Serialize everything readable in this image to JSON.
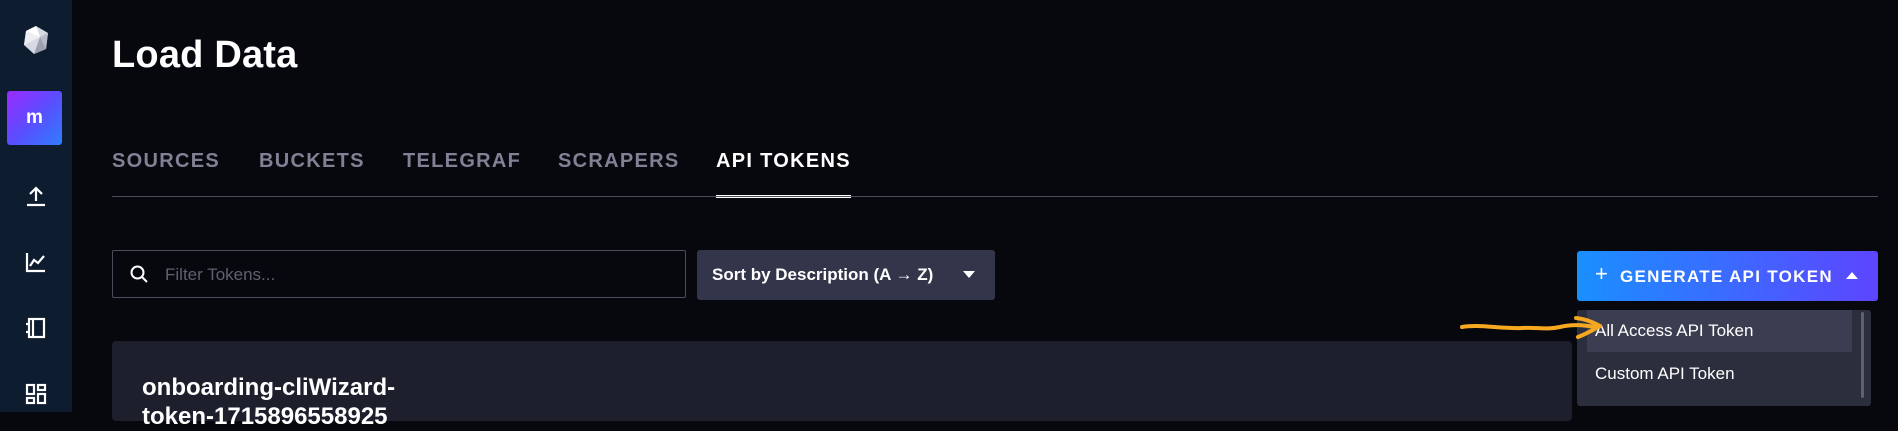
{
  "page": {
    "title": "Load Data"
  },
  "sidebar": {
    "org_initial": "m",
    "items": [
      {
        "name": "load-data",
        "icon": "upload-icon"
      },
      {
        "name": "explore",
        "icon": "chart-icon"
      },
      {
        "name": "notebooks",
        "icon": "notebook-icon"
      },
      {
        "name": "dashboards",
        "icon": "dashboard-icon"
      }
    ]
  },
  "tabs": [
    {
      "label": "SOURCES",
      "active": false
    },
    {
      "label": "BUCKETS",
      "active": false
    },
    {
      "label": "TELEGRAF",
      "active": false
    },
    {
      "label": "SCRAPERS",
      "active": false
    },
    {
      "label": "API TOKENS",
      "active": true
    }
  ],
  "search": {
    "placeholder": "Filter Tokens...",
    "value": ""
  },
  "sort": {
    "label": "Sort by Description (A → Z)"
  },
  "generate": {
    "plus": "+",
    "label": "GENERATE API TOKEN",
    "menu": [
      {
        "label": "All Access API Token",
        "highlighted": true
      },
      {
        "label": "Custom API Token",
        "highlighted": false
      }
    ]
  },
  "token_card": {
    "title_line1": "onboarding-cliWizard-",
    "title_line2": "token-1715896558925"
  },
  "colors": {
    "background": "#07070e",
    "sidebar": "#0e1c2f",
    "accent_from": "#1a8fff",
    "accent_to": "#5d45ff",
    "annotation": "#f6a821"
  }
}
